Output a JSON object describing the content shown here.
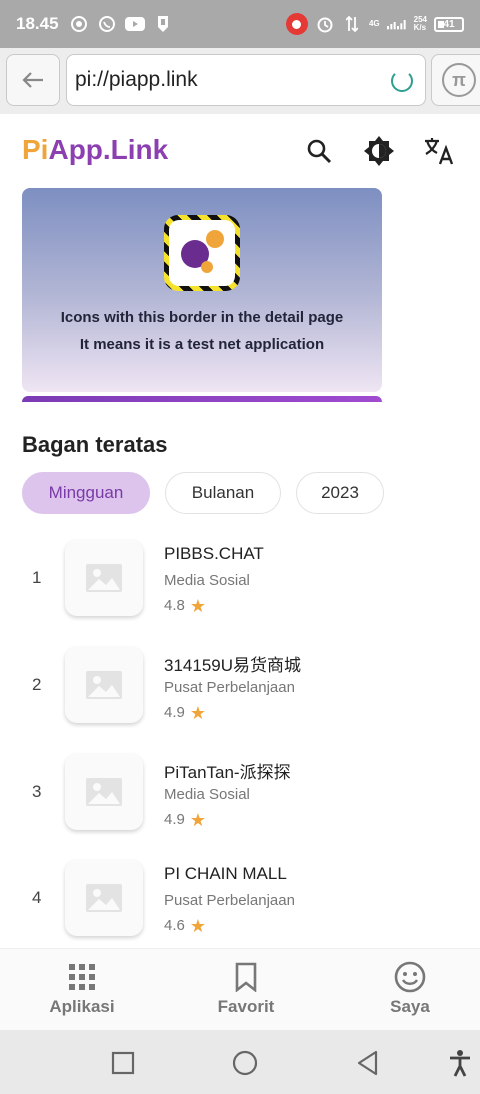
{
  "status_bar": {
    "time": "18.45",
    "network": "4G",
    "speed_top": "254",
    "speed_bottom": "K/s",
    "battery": "41"
  },
  "browser": {
    "url": "pi://piapp.link"
  },
  "header": {
    "logo_pi": "Pi",
    "logo_rest": "App.Link"
  },
  "banner": {
    "line1": "Icons with this border in the detail page",
    "line2": "It means it is a test net application"
  },
  "section": {
    "title": "Bagan teratas",
    "chips": [
      "Mingguan",
      "Bulanan",
      "2023"
    ],
    "active_chip": "Mingguan"
  },
  "apps": [
    {
      "rank": "1",
      "name": "PIBBS.CHAT",
      "category": "Media Sosial",
      "rating": "4.8"
    },
    {
      "rank": "2",
      "name": "314159U易货商城",
      "category": "Pusat Perbelanjaan",
      "rating": "4.9"
    },
    {
      "rank": "3",
      "name": "PiTanTan-派探探",
      "category": "Media Sosial",
      "rating": "4.9"
    },
    {
      "rank": "4",
      "name": "PI CHAIN MALL",
      "category": "Pusat Perbelanjaan",
      "rating": "4.6"
    }
  ],
  "bottom_nav": {
    "apps": "Aplikasi",
    "favorites": "Favorit",
    "me": "Saya"
  },
  "colors": {
    "brand_orange": "#f0a53a",
    "brand_purple": "#8b3fb0",
    "chip_active_bg": "#dcc4ec"
  }
}
